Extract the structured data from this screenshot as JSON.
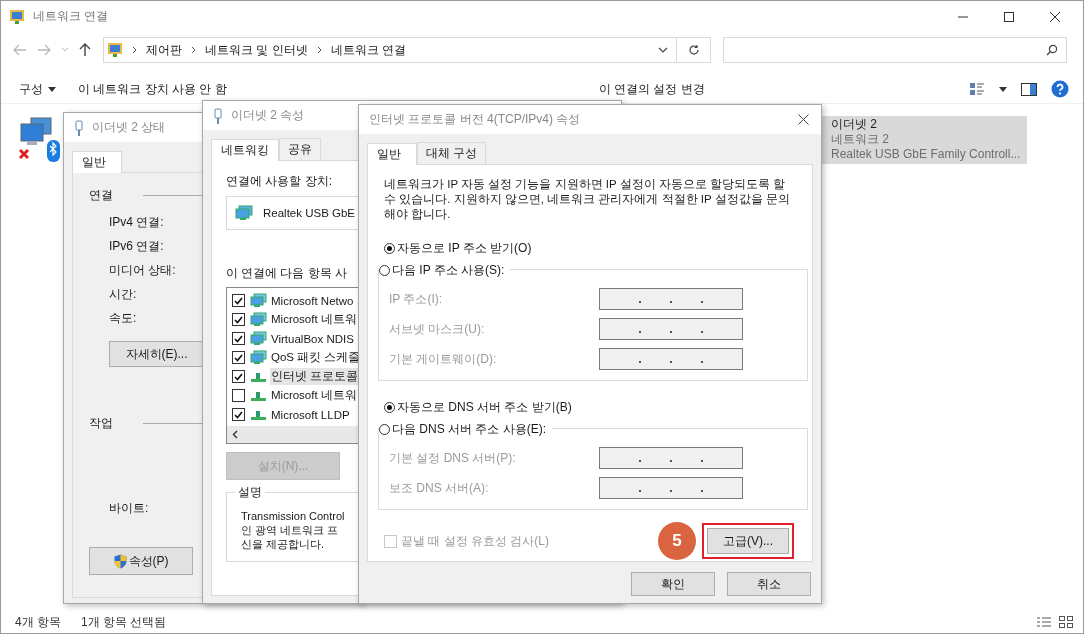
{
  "window": {
    "title": "네트워크 연결"
  },
  "address_bar": {
    "breadcrumbs": [
      "제어판",
      "네트워크 및 인터넷",
      "네트워크 연결"
    ]
  },
  "toolbar": [
    {
      "label": "구성",
      "menu": true
    },
    {
      "label": "이 네트워크 장치 사용 안 함",
      "menu": false
    },
    {
      "label": "이 연결의 설정 변경",
      "menu": false
    }
  ],
  "connections": [
    {
      "name": "이더넷 2",
      "network": "네트워크 2",
      "adapter": "Realtek USB GbE Family Controll...",
      "selected": true
    }
  ],
  "status_bar": [
    "4개 항목",
    "1개 항목 선택됨"
  ],
  "status_dialog": {
    "title": "이더넷 2 상태",
    "tabs": [
      {
        "label": "일반",
        "selected": true
      }
    ],
    "connection_heading": "연결",
    "connection_labels": [
      "IPv4 연결:",
      "IPv6 연결:",
      "미디어 상태:",
      "시간:",
      "속도:"
    ],
    "details_button": "자세히(E)...",
    "activity_heading": "작업",
    "activity_labels": [
      "바이트:"
    ],
    "properties_button": "속성(P)"
  },
  "properties_dialog": {
    "title": "이더넷 2 속성",
    "tabs": [
      {
        "label": "네트워킹",
        "selected": true
      },
      {
        "label": "공유",
        "selected": false
      }
    ],
    "device_label": "연결에 사용할 장치:",
    "device": "Realtek USB GbE",
    "items_label": "이 연결에 다음 항목 사",
    "items": [
      {
        "label": "Microsoft Netwo",
        "checked": true,
        "selected": false,
        "kind": "service"
      },
      {
        "label": "Microsoft 네트워",
        "checked": true,
        "selected": false,
        "kind": "service"
      },
      {
        "label": "VirtualBox NDIS",
        "checked": true,
        "selected": false,
        "kind": "service"
      },
      {
        "label": "QoS 패킷 스케줄",
        "checked": true,
        "selected": false,
        "kind": "service"
      },
      {
        "label": "인터넷 프로토콜",
        "checked": true,
        "selected": true,
        "kind": "protocol"
      },
      {
        "label": "Microsoft 네트워",
        "checked": false,
        "selected": false,
        "kind": "protocol"
      },
      {
        "label": "Microsoft LLDP",
        "checked": true,
        "selected": false,
        "kind": "protocol"
      }
    ],
    "install_button": {
      "label": "설치(N)...",
      "disabled": true
    },
    "description_heading": "설명",
    "description_lines": [
      "Transmission Control",
      "인 광역 네트워크 프",
      "신을 제공합니다."
    ]
  },
  "tcp_dialog": {
    "title": "인터넷 프로토콜 버전 4(TCP/IPv4) 속성",
    "tabs": [
      {
        "label": "일반",
        "selected": true
      },
      {
        "label": "대체 구성",
        "selected": false
      }
    ],
    "intro": "네트워크가 IP 자동 설정 기능을 지원하면 IP 설정이 자동으로 할당되도록 할 수 있습니다. 지원하지 않으면, 네트워크 관리자에게 적절한 IP 설정값을 문의해야 합니다.",
    "ip_auto": {
      "label": "자동으로 IP 주소 받기(O)",
      "selected": true
    },
    "ip_manual": {
      "label": "다음 IP 주소 사용(S):",
      "selected": false
    },
    "ip_fields": [
      {
        "label": "IP 주소(I):",
        "disabled": true
      },
      {
        "label": "서브넷 마스크(U):",
        "disabled": true
      },
      {
        "label": "기본 게이트웨이(D):",
        "disabled": true
      }
    ],
    "dns_auto": {
      "label": "자동으로 DNS 서버 주소 받기(B)",
      "selected": true
    },
    "dns_manual": {
      "label": "다음 DNS 서버 주소 사용(E):",
      "selected": false
    },
    "dns_fields": [
      {
        "label": "기본 설정 DNS 서버(P):",
        "disabled": true
      },
      {
        "label": "보조 DNS 서버(A):",
        "disabled": true
      }
    ],
    "validate": {
      "label": "끝낼 때 설정 유효성 검사(L)",
      "checked": false,
      "disabled": true
    },
    "step_badge": "5",
    "advanced_button": {
      "label": "고급(V)...",
      "highlighted": true
    },
    "buttons": [
      "확인",
      "취소"
    ]
  }
}
